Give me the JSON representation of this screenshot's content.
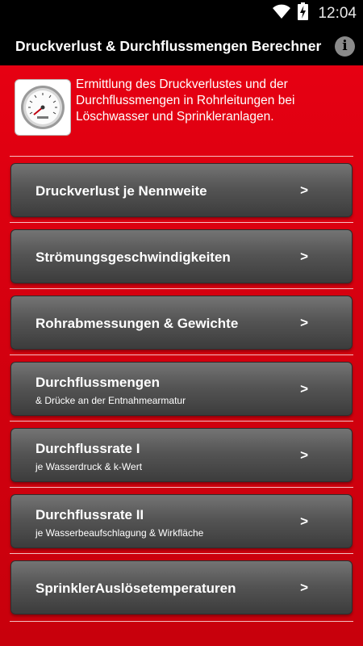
{
  "status_bar": {
    "time": "12:04",
    "icons": [
      "wifi-icon",
      "battery-charging-icon"
    ]
  },
  "action_bar": {
    "title": "Druckverlust & Durchflussmengen Berechner",
    "info_label": "i"
  },
  "header": {
    "icon": "pressure-gauge-icon",
    "description": "Ermittlung des Druckverlustes und der Durchflussmengen in Rohrleitungen bei Löschwasser und Sprinkleranlagen."
  },
  "menu": {
    "items": [
      {
        "label": "Druckverlust je Nennweite",
        "sub": "",
        "arrow": ">"
      },
      {
        "label": "Strömungsgeschwindigkeiten",
        "sub": "",
        "arrow": ">"
      },
      {
        "label": "Rohrabmessungen & Gewichte",
        "sub": "",
        "arrow": ">"
      },
      {
        "label": "Durchflussmengen",
        "sub": "& Drücke an der Entnahmearmatur",
        "arrow": ">"
      },
      {
        "label": "Durchflussrate I",
        "sub": "je Wasserdruck & k-Wert",
        "arrow": ">"
      },
      {
        "label": "Durchflussrate II",
        "sub": "je Wasserbeaufschlagung & Wirkfläche",
        "arrow": ">"
      },
      {
        "label": "SprinklerAuslösetemperaturen",
        "sub": "",
        "arrow": ">"
      }
    ]
  },
  "colors": {
    "background_red": "#e60012",
    "button_gray": "#555555",
    "bar_black": "#000000"
  }
}
